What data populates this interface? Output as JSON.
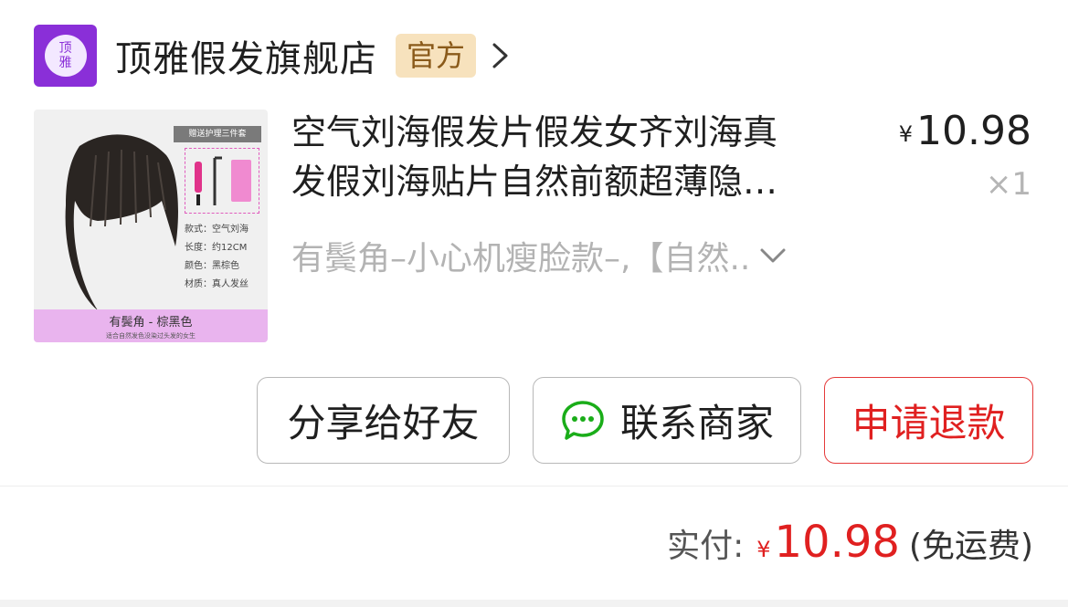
{
  "shop": {
    "logo_text_1": "顶",
    "logo_text_2": "雅",
    "name": "顶雅假发旗舰店",
    "badge": "官方"
  },
  "product": {
    "title_line1": "空气刘海假发片假发女齐刘海真",
    "title_line2": "发假刘海贴片自然前额超薄隐…",
    "currency": "¥",
    "price": "10.98",
    "quantity": "×1",
    "sku": "有鬓角–小心机瘦脸款–,【自然..",
    "image": {
      "gift_title": "赠送护理三件套",
      "specs": [
        "款式：空气刘海",
        "长度：约12CM",
        "颜色：黑棕色",
        "材质：真人发丝"
      ],
      "caption_main": "有鬓角 - 棕黑色",
      "caption_sub": "适合自然发色没染过头发的女生"
    }
  },
  "actions": {
    "share": "分享给好友",
    "contact": "联系商家",
    "refund": "申请退款"
  },
  "total": {
    "label": "实付:",
    "currency": "¥",
    "amount": "10.98",
    "note": "(免运费)"
  },
  "colors": {
    "brand_purple": "#8a2fd8",
    "price_red": "#e02020",
    "badge_bg": "#f7e2bd",
    "wechat_green": "#1aad19"
  }
}
